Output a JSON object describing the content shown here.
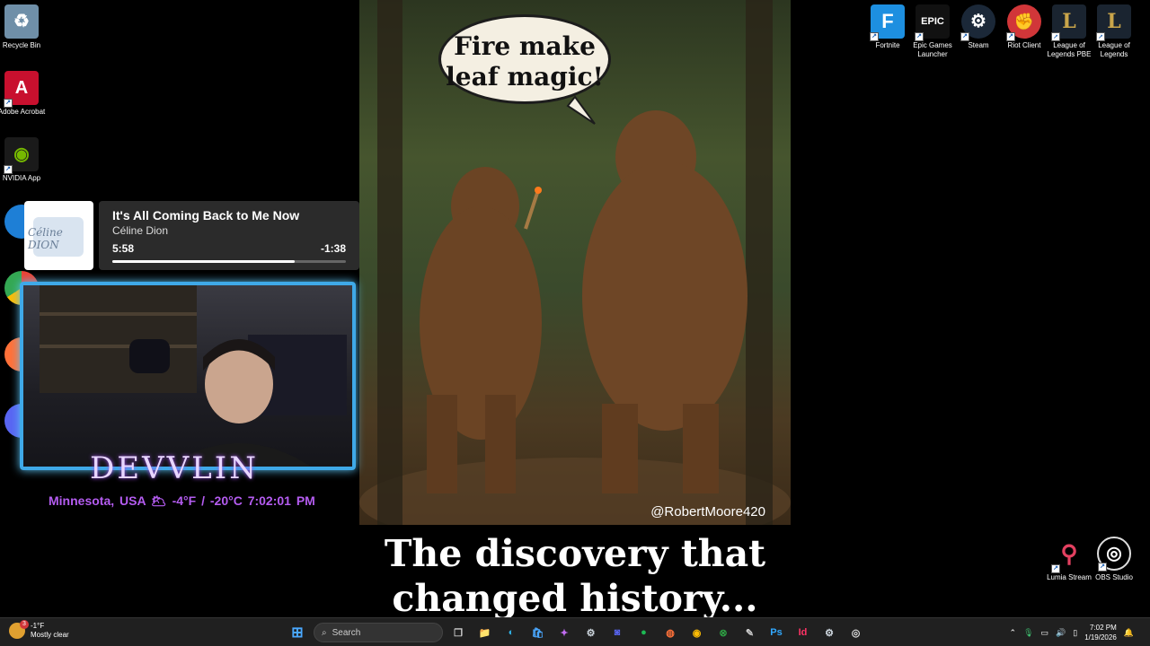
{
  "desktop_left": [
    {
      "label": "Recycle Bin",
      "icon": "recycle-bin-icon",
      "color": "#6f8fa8",
      "glyph": "♻"
    },
    {
      "label": "Adobe Acrobat",
      "icon": "adobe-acrobat-icon",
      "color": "#c8102e",
      "glyph": "A"
    },
    {
      "label": "NVIDIA App",
      "icon": "nvidia-icon",
      "color": "#76b900",
      "glyph": "◉"
    }
  ],
  "desktop_right": [
    {
      "label": "Fortnite",
      "icon": "fortnite-icon",
      "color": "#1d8fe0",
      "glyph": "F"
    },
    {
      "label": "Epic Games Launcher",
      "icon": "epic-games-icon",
      "color": "#222222",
      "glyph": "EPIC"
    },
    {
      "label": "Steam",
      "icon": "steam-icon",
      "color": "#1b2838",
      "glyph": "⚙"
    },
    {
      "label": "Riot Client",
      "icon": "riot-client-icon",
      "color": "#d13639",
      "glyph": "✊"
    },
    {
      "label": "League of Legends PBE",
      "icon": "league-pbe-icon",
      "color": "#1a2430",
      "glyph": "L"
    },
    {
      "label": "League of Legends",
      "icon": "league-icon",
      "color": "#1a2430",
      "glyph": "L"
    },
    {
      "label": "Lumia Stream",
      "icon": "lumia-stream-icon",
      "color": "#101010",
      "glyph": "⚲"
    },
    {
      "label": "OBS Studio",
      "icon": "obs-studio-icon",
      "color": "#101010",
      "glyph": "◎"
    }
  ],
  "art": {
    "bubble": "Fire make leaf magic!",
    "credit": "@RobertMoore420",
    "caption": "The discovery that changed history..."
  },
  "music": {
    "title": "It's All Coming Back to Me Now",
    "artist": "Céline Dion",
    "elapsed": "5:58",
    "remaining": "-1:38",
    "progress": 0.78,
    "cover_text": "Céline DION"
  },
  "overlay": {
    "name": "DEVVLIN",
    "weather": "Minnesota, USA 🌥 -4°F / -20°C  7:02:01 PM"
  },
  "taskbar": {
    "weather_temp": "-1°F",
    "weather_desc": "Mostly clear",
    "weather_badge": "3",
    "search_placeholder": "Search",
    "apps": [
      {
        "name": "start",
        "glyph": "⊞",
        "color": "#4aa8ff"
      },
      {
        "name": "task-view",
        "glyph": "❐",
        "color": "#cccccc"
      },
      {
        "name": "file-explorer",
        "glyph": "📁",
        "color": "#f2c744"
      },
      {
        "name": "edge",
        "glyph": "◐",
        "color": "#2fb3e8"
      },
      {
        "name": "microsoft-store",
        "glyph": "🛍",
        "color": "#4aa8ff"
      },
      {
        "name": "copilot",
        "glyph": "✦",
        "color": "#c06cf0"
      },
      {
        "name": "steam",
        "glyph": "⚙",
        "color": "#cfd8e0"
      },
      {
        "name": "discord",
        "glyph": "◙",
        "color": "#5865f2"
      },
      {
        "name": "spotify",
        "glyph": "●",
        "color": "#1db954"
      },
      {
        "name": "firefox",
        "glyph": "◍",
        "color": "#ff7139"
      },
      {
        "name": "chrome",
        "glyph": "◉",
        "color": "#fbbc05"
      },
      {
        "name": "xbox",
        "glyph": "⊗",
        "color": "#2ea043"
      },
      {
        "name": "editor",
        "glyph": "✎",
        "color": "#cccccc"
      },
      {
        "name": "photoshop",
        "glyph": "Ps",
        "color": "#31a8ff"
      },
      {
        "name": "indesign",
        "glyph": "Id",
        "color": "#ff3366"
      },
      {
        "name": "steam-2",
        "glyph": "⚙",
        "color": "#cfd8e0"
      },
      {
        "name": "obs",
        "glyph": "◎",
        "color": "#dddddd"
      }
    ],
    "time": "7:02 PM",
    "date": "1/19/2026"
  }
}
